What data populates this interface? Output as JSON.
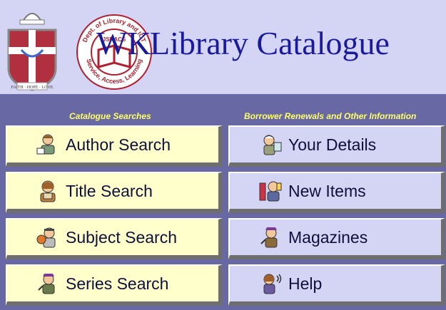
{
  "header": {
    "title": "Library Catalogue",
    "title_prefix": "WK",
    "crest_motto": "FAITH · HOPE · LOVE",
    "seal_top_text": "Dept. of Library and ICT",
    "seal_bottom_text": "Service, Access, Learning",
    "seal_center_text": "JSRACS"
  },
  "columns": {
    "left_heading": "Catalogue Searches",
    "right_heading": "Borrower Renewals and Other Information"
  },
  "left_buttons": [
    {
      "label": "Author Search",
      "icon": "author-icon"
    },
    {
      "label": "Title Search",
      "icon": "reader-icon"
    },
    {
      "label": "Subject Search",
      "icon": "subject-icon"
    },
    {
      "label": "Series Search",
      "icon": "series-icon"
    }
  ],
  "right_buttons": [
    {
      "label": "Your Details",
      "icon": "details-icon"
    },
    {
      "label": "New Items",
      "icon": "new-items-icon"
    },
    {
      "label": "Magazines",
      "icon": "magazines-icon"
    },
    {
      "label": "Help",
      "icon": "help-icon"
    }
  ],
  "colors": {
    "background": "#d4d4f4",
    "panel": "#6868a4",
    "heading": "#ffff66",
    "left_button": "#ffffcc",
    "right_button": "#d4d4f4",
    "title": "#1a1a9c"
  }
}
